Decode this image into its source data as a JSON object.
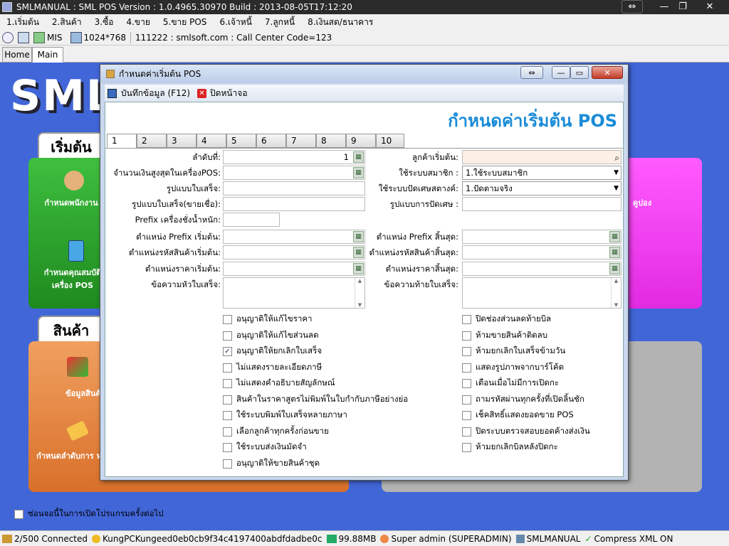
{
  "window": {
    "title": "SMLMANUAL : SML POS Version : 1.0.4965.30970  Build : 2013-08-05T17:12:20",
    "controls": [
      "⇔",
      "—",
      "❐",
      "✕"
    ]
  },
  "menu": [
    "1.เริ่มต้น",
    "2.สินค้า",
    "3.ซื้อ",
    "4.ขาย",
    "5.ขาย POS",
    "6.เจ้าหนี้",
    "7.ลูกหนี้",
    "8.เงินสด/ธนาคาร"
  ],
  "toolbar": {
    "mis_label": "MIS",
    "resolution": "1024*768",
    "info": "111222 : smlsoft.com : Call Center Code=123"
  },
  "tabs": [
    "Home",
    "Main"
  ],
  "background": {
    "logo_text": "SML",
    "panel1_title": "เริ่มต้น",
    "panel1_item1": "กำหนดพนักงาน",
    "panel1_item2": "กำหนดคุณสมบัติ เครื่อง POS",
    "panel2_title": "สินค้า",
    "panel2_item1": "ข้อมูลสินค้า",
    "panel2_item2": "กำหนดลำดับการ หา",
    "panel3_item": "คูปอง",
    "startup_check": "ซ่อนจอนี้ในการเปิดโปรแกรมครั้งต่อไป"
  },
  "dialog": {
    "title": "กำหนดค่าเริ่มต้น POS",
    "save_label": "บันทึกข้อมูล (F12)",
    "close_label": "ปิดหน้าจอ",
    "heading": "กำหนดค่าเริ่มต้น POS",
    "tabs": [
      "1",
      "2",
      "3",
      "4",
      "5",
      "6",
      "7",
      "8",
      "9",
      "10"
    ],
    "left_fields": {
      "seq_label": "ลำดับที่:",
      "seq_value": "1",
      "max_cash_label": "จำนวนเงินสูงสุดในเครื่องPOS:",
      "receipt_format_label": "รูปแบบใบเสร็จ:",
      "receipt_credit_label": "รูปแบบใบเสร็จ(ขายเชื่อ):",
      "prefix_scale_label": "Prefix เครื่องชั่งน้ำหนัก:",
      "prefix_start_label": "ตำแหน่ง Prefix เริ่มต้น:",
      "code_start_label": "ตำแหน่งรหัสสินค้าเริ่มต้น:",
      "price_start_label": "ตำแหน่งราคาเริ่มต้น:",
      "header_msg_label": "ข้อความหัวใบเสร็จ:"
    },
    "right_fields": {
      "default_customer_label": "ลูกค้าเริ่มต้น:",
      "member_system_label": "ใช้ระบบสมาชิก :",
      "member_system_value": "1.ใช้ระบบสมาชิก",
      "rounding_label": "ใช้ระบบปัดเศษสตางค์:",
      "rounding_value": "1.ปัดตามจริง",
      "rounding_format_label": "รูปแบบการปัดเศษ :",
      "prefix_end_label": "ตำแหน่ง Prefix สิ้นสุด:",
      "code_end_label": "ตำแหน่งรหัสสินค้าสิ้นสุด:",
      "price_end_label": "ตำแหน่งราคาสิ้นสุด:",
      "footer_msg_label": "ข้อความท้ายใบเสร็จ:"
    },
    "left_checks": [
      {
        "label": "อนุญาติให้แก้ไขราคา",
        "checked": false
      },
      {
        "label": "อนุญาติให้แก้ไขส่วนลด",
        "checked": false
      },
      {
        "label": "อนุญาติให้ยกเลิกใบเสร็จ",
        "checked": true
      },
      {
        "label": "ไม่แสดงรายละเอียดภาษี",
        "checked": false
      },
      {
        "label": "ไม่แสดงคำอธิบายสัญลักษณ์",
        "checked": false
      },
      {
        "label": "สินค้าในราคาสูตรไม่พิมพ์ในใบกำกับภาษีอย่างย่อ",
        "checked": false
      },
      {
        "label": "ใช้ระบบพิมพ์ใบเสร็จหลายภาษา",
        "checked": false
      },
      {
        "label": "เลือกลูกค้าทุกครั้งก่อนขาย",
        "checked": false
      },
      {
        "label": "ใช้ระบบส่งเงินมัดจำ",
        "checked": false
      },
      {
        "label": "อนุญาติให้ขายสินค้าชุด",
        "checked": false
      }
    ],
    "right_checks": [
      {
        "label": "ปิดช่องส่วนลดท้ายบิล",
        "checked": false
      },
      {
        "label": "ห้ามขายสินค้าติดลบ",
        "checked": false
      },
      {
        "label": "ห้ามยกเลิกใบเสร็จข้ามวัน",
        "checked": false
      },
      {
        "label": "แสดงรูปภาพจากบาร์โค้ด",
        "checked": false
      },
      {
        "label": "เตือนเมื่อไม่มีการเปิดกะ",
        "checked": false
      },
      {
        "label": "ถามรหัสผ่านทุกครั้งที่เปิดลิ้นชัก",
        "checked": false
      },
      {
        "label": "เช็คสิทธิ์แสดงยอดขาย POS",
        "checked": false
      },
      {
        "label": "ปิดระบบตรวจสอบยอดค้างส่งเงิน",
        "checked": false
      },
      {
        "label": "ห้ามยกเลิกบิลหลังปิดกะ",
        "checked": false
      }
    ]
  },
  "status": {
    "connected": "2/500 Connected",
    "key": "KungPCKungeed0eb0cb9f34c4197400abdfdadbe0c",
    "memory": "99.88MB",
    "user": "Super admin (SUPERADMIN)",
    "db": "SMLMANUAL",
    "compress": "Compress XML ON"
  }
}
